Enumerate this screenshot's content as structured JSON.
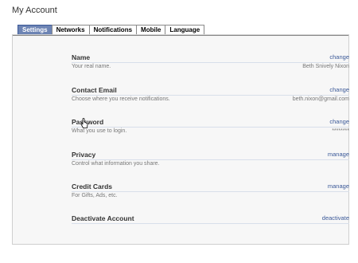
{
  "page": {
    "title": "My Account"
  },
  "tabs": [
    {
      "label": "Settings",
      "active": true
    },
    {
      "label": "Networks",
      "active": false
    },
    {
      "label": "Notifications",
      "active": false
    },
    {
      "label": "Mobile",
      "active": false
    },
    {
      "label": "Language",
      "active": false
    }
  ],
  "settings": [
    {
      "title": "Name",
      "action": "change",
      "description": "Your real name.",
      "value": "Beth Snively Nixon"
    },
    {
      "title": "Contact Email",
      "action": "change",
      "description": "Choose where you receive notifications.",
      "value": "beth.nixon@gmail.com"
    },
    {
      "title": "Password",
      "action": "change",
      "description": "What you use to login.",
      "value": "********"
    },
    {
      "title": "Privacy",
      "action": "manage",
      "description": "Control what information you share.",
      "value": ""
    },
    {
      "title": "Credit Cards",
      "action": "manage",
      "description": "For Gifts, Ads, etc.",
      "value": ""
    },
    {
      "title": "Deactivate Account",
      "action": "deactivate",
      "description": "",
      "value": ""
    }
  ],
  "colors": {
    "accent": "#3b5998",
    "tab_active_bg": "#6d84b4"
  },
  "icons": {
    "cursor": "hand-pointer-icon"
  }
}
